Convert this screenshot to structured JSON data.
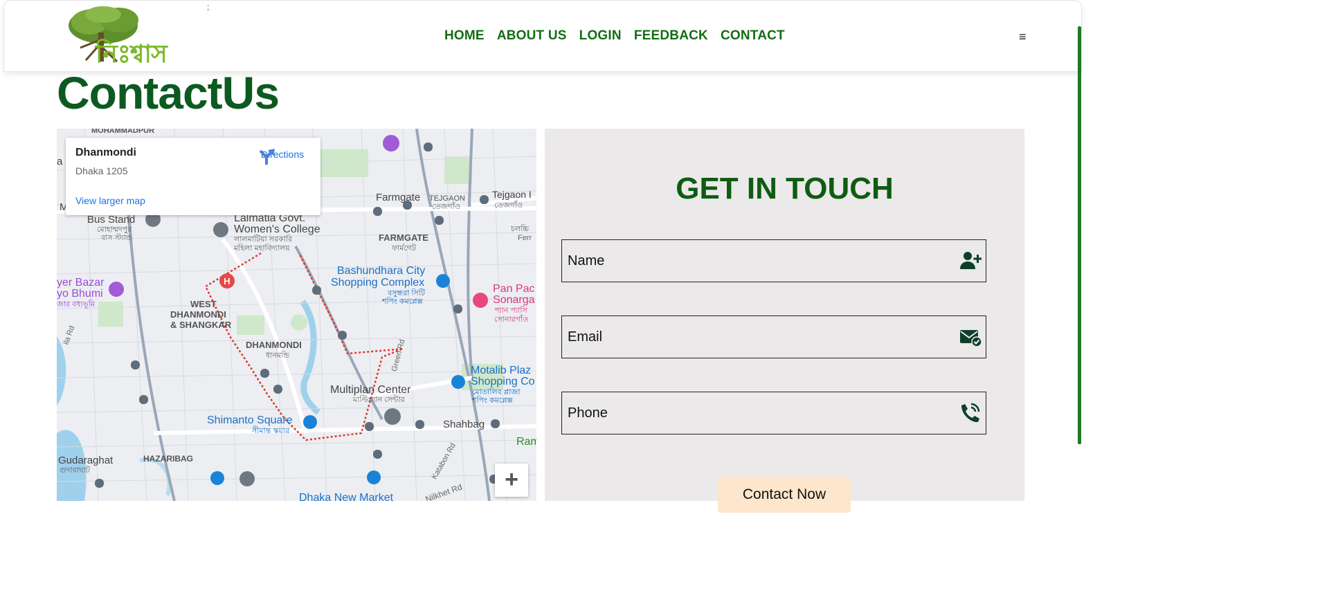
{
  "header": {
    "logo_text": "নিঃশ্বাস",
    "nav": [
      "HOME",
      "ABOUT US",
      "LOGIN",
      "FEEDBACK",
      "CONTACT"
    ],
    "menu_icon": "hamburger-icon",
    "stray_char": ";"
  },
  "page_title": "ContactUs",
  "map": {
    "place": "Dhanmondi",
    "address": "Dhaka 1205",
    "directions_label": "Directions",
    "larger_map_label": "View larger map",
    "zoom_in": "+",
    "labels": [
      {
        "text": "MOHAMMADPUR",
        "cls": "area"
      },
      {
        "text": "Farmgate",
        "cls": "big"
      },
      {
        "text": "TEJGAON",
        "cls": "area"
      },
      {
        "text": "তেজগাঁও",
        "cls": "bn"
      },
      {
        "text": "Tejgaon I",
        "cls": "big"
      },
      {
        "text": "তেজগাঁও",
        "cls": "bn"
      },
      {
        "text": "Bus Stand",
        "cls": "big"
      },
      {
        "text": "মোহাম্মদপুর",
        "cls": "bn"
      },
      {
        "text": "বাস স্ট্যান্ড",
        "cls": "bn"
      },
      {
        "text": "Lalmatia Govt.",
        "cls": "big"
      },
      {
        "text": "Women's College",
        "cls": "big"
      },
      {
        "text": "লালমাটিয়া সরকারি",
        "cls": "bn"
      },
      {
        "text": "মহিলা মহাবিদ্যালয়",
        "cls": "bn"
      },
      {
        "text": "FARMGATE",
        "cls": "area"
      },
      {
        "text": "ফার্মগেট",
        "cls": "bn"
      },
      {
        "text": "চলচ্চি",
        "cls": "bn"
      },
      {
        "text": "Ferr",
        "cls": "bn"
      },
      {
        "text": "Bashundhara City",
        "cls": "blue"
      },
      {
        "text": "Shopping Complex",
        "cls": "blue"
      },
      {
        "text": "বসুন্ধরা সিটি",
        "cls": "bluebn"
      },
      {
        "text": "শপিং কমপ্লেক্স",
        "cls": "bluebn"
      },
      {
        "text": "Pan Pac",
        "cls": "pink"
      },
      {
        "text": "Sonarga",
        "cls": "pink"
      },
      {
        "text": "প্যান প্যাসি",
        "cls": "pinkbn"
      },
      {
        "text": "সোনারগাঁও",
        "cls": "pinkbn"
      },
      {
        "text": "yer Bazar",
        "cls": "purple"
      },
      {
        "text": "yo Bhumi",
        "cls": "purple"
      },
      {
        "text": "জার বধ্যভূমি",
        "cls": "purplebn"
      },
      {
        "text": "WEST",
        "cls": "area"
      },
      {
        "text": "DHANMONDI",
        "cls": "area"
      },
      {
        "text": "& SHANGKAR",
        "cls": "area"
      },
      {
        "text": "DHANMONDI",
        "cls": "area"
      },
      {
        "text": "ধানমন্ডি",
        "cls": "bn"
      },
      {
        "text": "Green Rd",
        "cls": "road"
      },
      {
        "text": "Motalib Plaz",
        "cls": "blue"
      },
      {
        "text": "Shopping Co",
        "cls": "blue"
      },
      {
        "text": "মোতালিব প্লাজা",
        "cls": "bluebn"
      },
      {
        "text": "শপিং কমপ্লেক্স",
        "cls": "bluebn"
      },
      {
        "text": "Multiplan Center",
        "cls": "big"
      },
      {
        "text": "মাল্টিপ্ল্যান সেন্টার",
        "cls": "bn"
      },
      {
        "text": "Shimanto Square",
        "cls": "blue"
      },
      {
        "text": "সীমান্ত স্কয়ার",
        "cls": "bluebn"
      },
      {
        "text": "Shahbag",
        "cls": "big"
      },
      {
        "text": "Ram",
        "cls": "green"
      },
      {
        "text": "Gudaraghat",
        "cls": "big"
      },
      {
        "text": "গুদারাঘাট",
        "cls": "bn"
      },
      {
        "text": "HAZARIBAG",
        "cls": "area"
      },
      {
        "text": "Katabon Rd",
        "cls": "road"
      },
      {
        "text": "Nilkhet Rd",
        "cls": "road"
      },
      {
        "text": "Dhaka New Market",
        "cls": "blue"
      },
      {
        "text": "ila Rd",
        "cls": "road"
      },
      {
        "text": "a",
        "cls": "big"
      },
      {
        "text": "M",
        "cls": "big"
      },
      {
        "text": "H",
        "cls": "pin"
      }
    ]
  },
  "contact": {
    "heading": "GET IN TOUCH",
    "name_placeholder": "Name",
    "email_placeholder": "Email",
    "phone_placeholder": "Phone",
    "submit_label": "Contact Now"
  },
  "colors": {
    "nav": "#136d13",
    "title": "#0d5a21",
    "heading": "#0e5c12",
    "panel_bg": "#ebe9ea",
    "button_bg": "#fde6cc"
  }
}
